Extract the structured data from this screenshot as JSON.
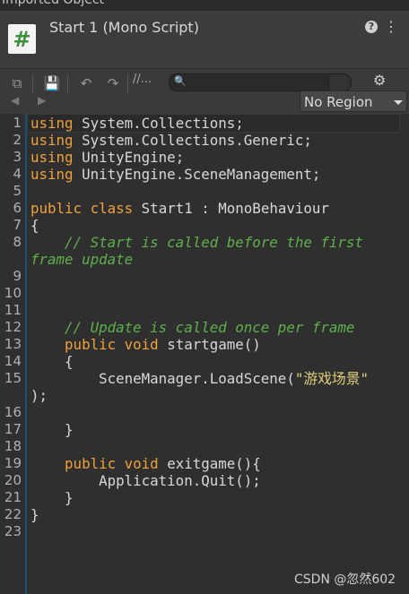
{
  "window": {
    "topbar_text": "Imported Object"
  },
  "header": {
    "icon_glyph": "#",
    "title": "Start 1 (Mono Script)",
    "help_icon": "help-icon",
    "menu_icon": "more-vert-icon"
  },
  "toolbar": {
    "comment_label": "//...",
    "search_value": "",
    "region_label": "No Region",
    "icons": {
      "open": "⧉",
      "save": "💾",
      "undo": "↶",
      "redo": "↷",
      "mag": "🔍",
      "gear": "⚙",
      "back": "◀",
      "forward": "▶",
      "help": "?",
      "menu": "⋮"
    }
  },
  "code": {
    "line_numbers": [
      "1",
      "2",
      "3",
      "4",
      "5",
      "6",
      "7",
      "8",
      "9",
      "10",
      "11",
      "12",
      "13",
      "14",
      "15",
      "16",
      "17",
      "18",
      "19",
      "20",
      "21",
      "22",
      "23"
    ],
    "lines": [
      [
        {
          "t": "using",
          "c": "kw"
        },
        {
          "t": " System.Collections;",
          "c": ""
        }
      ],
      [
        {
          "t": "using",
          "c": "kw"
        },
        {
          "t": " System.Collections.Generic;",
          "c": ""
        }
      ],
      [
        {
          "t": "using",
          "c": "kw"
        },
        {
          "t": " UnityEngine;",
          "c": ""
        }
      ],
      [
        {
          "t": "using",
          "c": "kw"
        },
        {
          "t": " UnityEngine.SceneManagement;",
          "c": ""
        }
      ],
      [],
      [
        {
          "t": "public",
          "c": "kw"
        },
        {
          "t": " ",
          "c": ""
        },
        {
          "t": "class",
          "c": "kw"
        },
        {
          "t": " Start1 : MonoBehaviour",
          "c": ""
        }
      ],
      [
        {
          "t": "{",
          "c": ""
        }
      ],
      [
        {
          "t": "    // Start is called before the first",
          "c": "cm"
        }
      ],
      [
        {
          "t": "frame update",
          "c": "cm"
        }
      ],
      [],
      [],
      [],
      [
        {
          "t": "    // Update is called once per frame",
          "c": "cm"
        }
      ],
      [
        {
          "t": "    ",
          "c": ""
        },
        {
          "t": "public",
          "c": "kw"
        },
        {
          "t": " ",
          "c": ""
        },
        {
          "t": "void",
          "c": "kw"
        },
        {
          "t": " startgame()",
          "c": ""
        }
      ],
      [
        {
          "t": "    {",
          "c": ""
        }
      ],
      [
        {
          "t": "        SceneManager.LoadScene(",
          "c": ""
        },
        {
          "t": "\"游戏场景\"",
          "c": "st"
        }
      ],
      [
        {
          "t": ");",
          "c": ""
        }
      ],
      [],
      [
        {
          "t": "    }",
          "c": ""
        }
      ],
      [],
      [
        {
          "t": "    ",
          "c": ""
        },
        {
          "t": "public",
          "c": "kw"
        },
        {
          "t": " ",
          "c": ""
        },
        {
          "t": "void",
          "c": "kw"
        },
        {
          "t": " exitgame(){",
          "c": ""
        }
      ],
      [
        {
          "t": "        Application.Quit();",
          "c": ""
        }
      ],
      [
        {
          "t": "    }",
          "c": ""
        }
      ],
      [
        {
          "t": "}",
          "c": ""
        }
      ],
      []
    ]
  },
  "watermark": "CSDN @忽然602",
  "colors": {
    "keyword": "#f0a13a",
    "comment": "#5fb04b",
    "string": "#e0d07a",
    "text": "#d8d8d8"
  }
}
